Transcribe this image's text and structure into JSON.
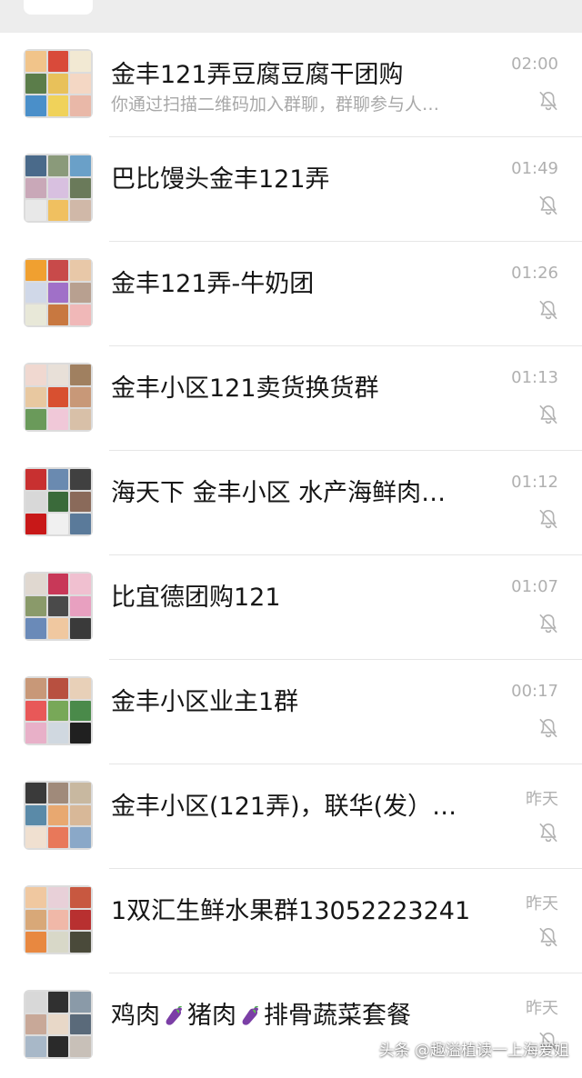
{
  "colors": {
    "background": "#ffffff",
    "title_text": "#161616",
    "secondary_text": "#a8a8a8",
    "time_text": "#b0b0b0",
    "mute_icon": "#b3b3b3",
    "divider": "#e6e6e6"
  },
  "chats": [
    {
      "title": "金丰121弄豆腐豆腐干团购",
      "preview": "你通过扫描二维码加入群聊，群聊参与人…",
      "time": "02:00",
      "muted": true,
      "avatar_icon": "group-grid-avatar",
      "avatar_colors": [
        "#f1c48a",
        "#d94a3a",
        "#f2e9d3",
        "#5b7d4a",
        "#e8c15a",
        "#f4d7c4",
        "#4a8fc9",
        "#f0d25a",
        "#e9b8a8"
      ]
    },
    {
      "title": "巴比馒头金丰121弄",
      "time": "01:49",
      "muted": true,
      "avatar_icon": "group-grid-avatar",
      "avatar_colors": [
        "#4a6a8a",
        "#8a9a7a",
        "#6aa0c8",
        "#c9a8b8",
        "#d8c0e0",
        "#6a7a5a",
        "#e8e8e8",
        "#f0c060",
        "#d0b8a8"
      ]
    },
    {
      "title": "金丰121弄-牛奶团",
      "time": "01:26",
      "muted": true,
      "avatar_icon": "group-grid-avatar",
      "avatar_colors": [
        "#f0a030",
        "#c84a4a",
        "#e8c8a8",
        "#d0d8e8",
        "#a070c8",
        "#b8a090",
        "#e8e8d8",
        "#c87840",
        "#f0b8b8"
      ]
    },
    {
      "title": "金丰小区121卖货换货群",
      "time": "01:13",
      "muted": true,
      "avatar_icon": "group-grid-avatar",
      "avatar_colors": [
        "#f0d8d0",
        "#e8e0d8",
        "#a08060",
        "#e8c8a0",
        "#d85030",
        "#c89878",
        "#6a9a5a",
        "#f0c8d8",
        "#d8c0a8"
      ]
    },
    {
      "title": "海天下 金丰小区 水产海鲜肉…",
      "time": "01:12",
      "muted": true,
      "avatar_icon": "group-grid-avatar",
      "avatar_colors": [
        "#c83030",
        "#6a8ab0",
        "#404040",
        "#d8d8d8",
        "#3a6a3a",
        "#8a6a5a",
        "#c81818",
        "#f0f0f0",
        "#5a7a9a"
      ]
    },
    {
      "title": "比宜德团购121",
      "time": "01:07",
      "muted": true,
      "avatar_icon": "group-grid-avatar",
      "avatar_colors": [
        "#e0d8d0",
        "#c83858",
        "#f0c0d0",
        "#8a9a6a",
        "#4a4a4a",
        "#e8a0c0",
        "#6a8ab8",
        "#f0c8a0",
        "#3a3a3a"
      ]
    },
    {
      "title": "金丰小区业主1群",
      "time": "00:17",
      "muted": true,
      "avatar_icon": "group-grid-avatar",
      "avatar_colors": [
        "#c89878",
        "#b85040",
        "#e8d0b8",
        "#e85858",
        "#78a858",
        "#4a8a4a",
        "#e8b0c8",
        "#d0d8e0",
        "#202020"
      ]
    },
    {
      "title": "金丰小区(121弄)，联华(发）…",
      "time": "昨天",
      "muted": true,
      "avatar_icon": "group-grid-avatar",
      "avatar_colors": [
        "#3a3a3a",
        "#a08a7a",
        "#c8b8a0",
        "#5a8aa8",
        "#e8a870",
        "#d8b898",
        "#f0e0d0",
        "#e8785a",
        "#8aa8c8"
      ]
    },
    {
      "title": "1双汇生鲜水果群13052223241",
      "time": "昨天",
      "muted": true,
      "avatar_icon": "group-grid-avatar",
      "avatar_colors": [
        "#f0c8a0",
        "#e8d0d8",
        "#c85840",
        "#d8a878",
        "#f0b8a8",
        "#b83030",
        "#e88840",
        "#d8d8c8",
        "#4a4a3a"
      ]
    },
    {
      "title": "鸡肉🍆 猪肉🍆 排骨蔬菜套餐",
      "title_parts": [
        "鸡肉",
        "猪肉",
        "排骨蔬菜套餐"
      ],
      "time": "昨天",
      "muted": true,
      "avatar_icon": "group-grid-avatar",
      "avatar_colors": [
        "#d8d8d8",
        "#303030",
        "#8a9aa8",
        "#c8a898",
        "#e8d8c8",
        "#5a6a7a",
        "#a8b8c8",
        "#2a2a2a",
        "#c8c0b8"
      ]
    }
  ],
  "watermark": "头条 @趣溢植读一上海爱姐",
  "icons": {
    "mute": "bell-slash-icon",
    "emoji_in_title": "eggplant-icon"
  }
}
